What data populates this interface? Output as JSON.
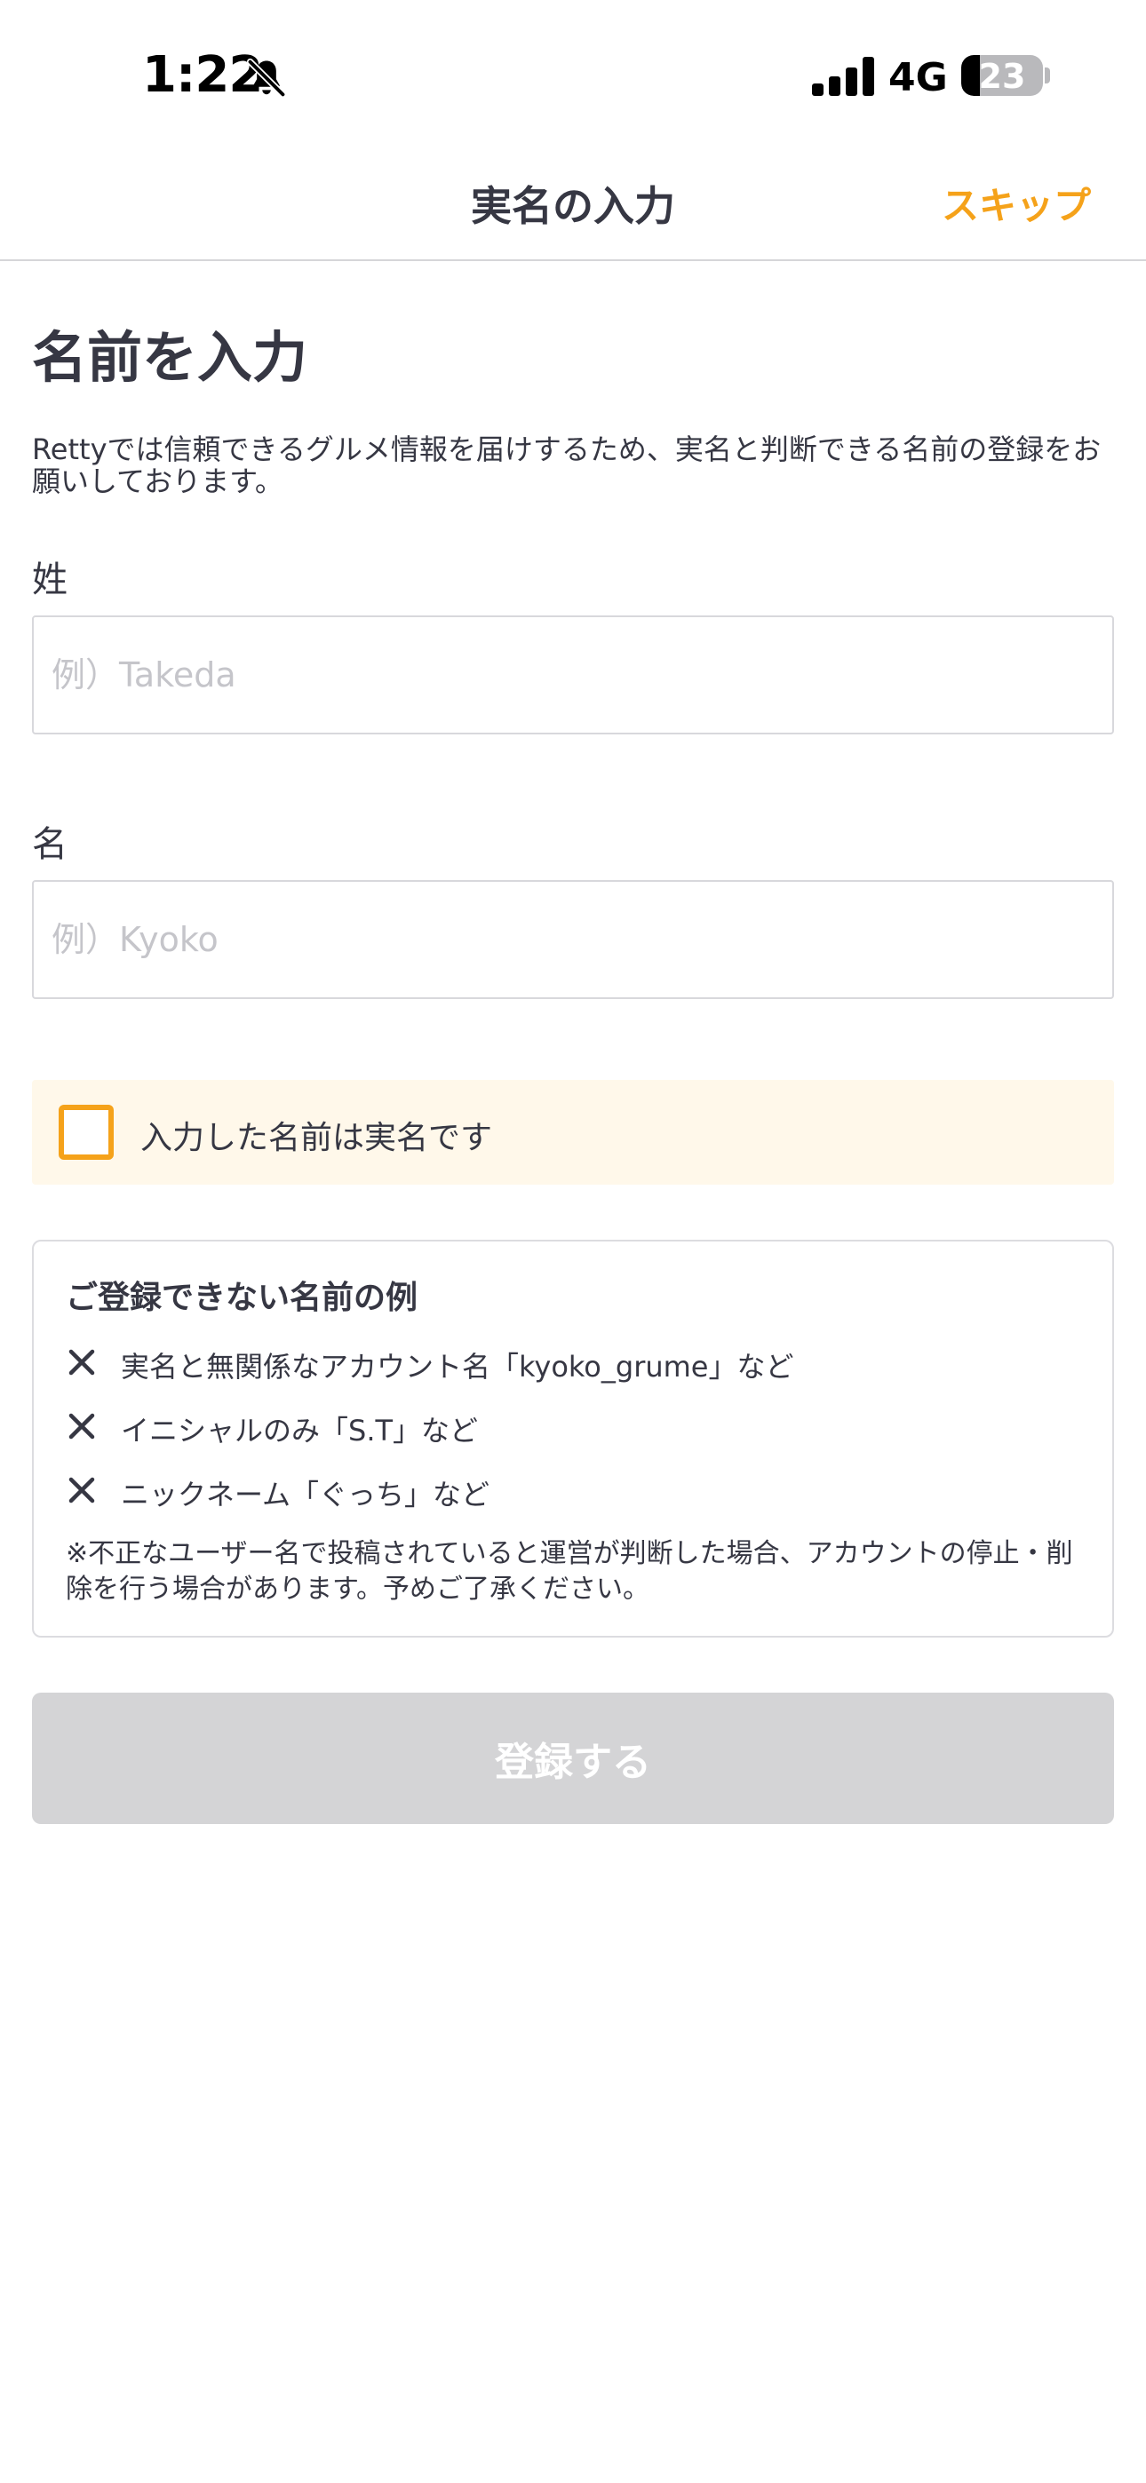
{
  "status_bar": {
    "time": "1:22",
    "network": "4G",
    "battery_percent": "23",
    "battery_level": 0.23,
    "signal_bars": 4
  },
  "nav": {
    "title": "実名の入力",
    "skip_label": "スキップ"
  },
  "content": {
    "heading": "名前を入力",
    "description": "Rettyでは信頼できるグルメ情報を届けするため、実名と判断できる名前の登録をお願いしております。",
    "last_name": {
      "label": "姓",
      "placeholder": "例）Takeda",
      "value": ""
    },
    "first_name": {
      "label": "名",
      "placeholder": "例）Kyoko",
      "value": ""
    },
    "confirm": {
      "label": "入力した名前は実名です",
      "checked": false
    },
    "examples": {
      "title": "ご登録できない名前の例",
      "items": [
        "実名と無関係なアカウント名「kyoko_grume」など",
        "イニシャルのみ「S.T」など",
        "ニックネーム「ぐっち」など"
      ],
      "note": "※不正なユーザー名で投稿されていると運営が判断した場合、アカウントの停止・削除を行う場合があります。予めご了承ください。"
    },
    "submit_label": "登録する"
  },
  "colors": {
    "accent": "#f5a21a",
    "text": "#363743",
    "confirm_bg": "#fff8ea",
    "disabled_button": "#d4d4d6"
  },
  "icons": {
    "bell": "bell-slash-icon",
    "example_mark": "close-icon"
  }
}
